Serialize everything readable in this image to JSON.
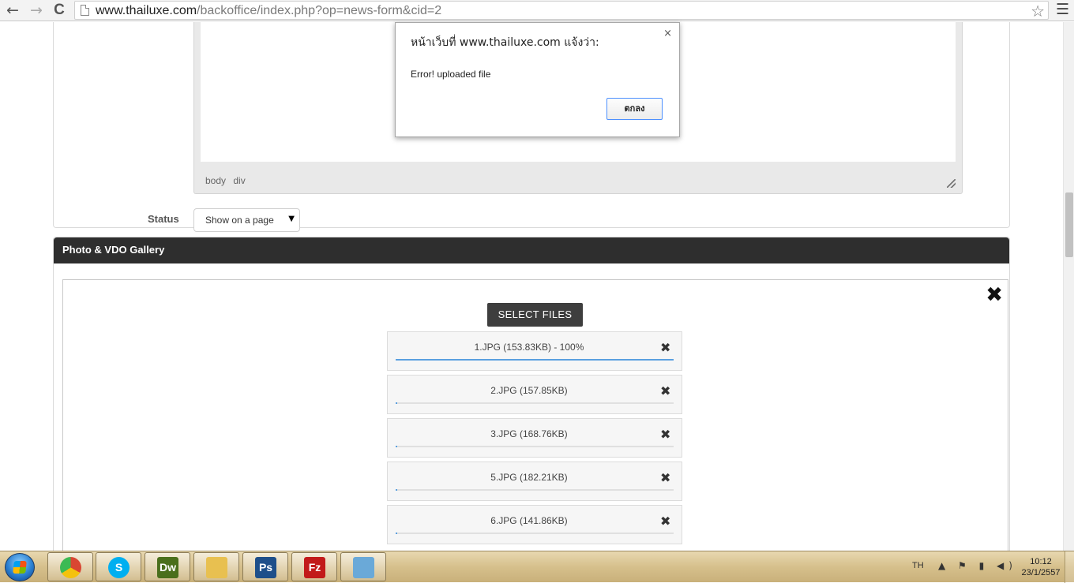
{
  "browser": {
    "url_host": "www.thailuxe.com",
    "url_path": "/backoffice/index.php?op=news-form&cid=2",
    "back_icon": "←",
    "forward_icon": "→",
    "reload_icon": "C",
    "star_icon": "☆",
    "menu_icon": "☰"
  },
  "editor": {
    "path": [
      "body",
      "div"
    ]
  },
  "status": {
    "label": "Status",
    "selected": "Show on a page",
    "caret": "▼"
  },
  "gallery": {
    "title": "Photo & VDO Gallery",
    "close_icon": "✖",
    "select_files_label": "SELECT FILES",
    "files": [
      {
        "name": "1.JPG (153.83KB) - 100%",
        "remove": "✖",
        "progress": 1.0
      },
      {
        "name": "2.JPG (157.85KB)",
        "remove": "✖",
        "progress": 0.005
      },
      {
        "name": "3.JPG (168.76KB)",
        "remove": "✖",
        "progress": 0.005
      },
      {
        "name": "5.JPG (182.21KB)",
        "remove": "✖",
        "progress": 0.005
      },
      {
        "name": "6.JPG (141.86KB)",
        "remove": "✖",
        "progress": 0.005
      }
    ]
  },
  "alert": {
    "title": "หน้าเว็บที่ www.thailuxe.com แจ้งว่า:",
    "close_icon": "×",
    "message": "Error! uploaded file",
    "ok_label": "ตกลง"
  },
  "taskbar": {
    "apps": [
      {
        "name": "chrome",
        "label": "",
        "color": "#d94632"
      },
      {
        "name": "skype",
        "label": "S",
        "color": "#00aff0"
      },
      {
        "name": "dreamweaver",
        "label": "Dw",
        "color": "#4a6f1c"
      },
      {
        "name": "explorer",
        "label": "",
        "color": "#e8c050"
      },
      {
        "name": "photoshop",
        "label": "Ps",
        "color": "#1e4f8a"
      },
      {
        "name": "filezilla",
        "label": "Fz",
        "color": "#c21a1a"
      },
      {
        "name": "notes",
        "label": "",
        "color": "#6aa9d8"
      }
    ],
    "lang": "TH",
    "tray_icons": "▲ ⚑ ▮ ◀)",
    "time": "10:12",
    "date": "23/1/2557"
  }
}
